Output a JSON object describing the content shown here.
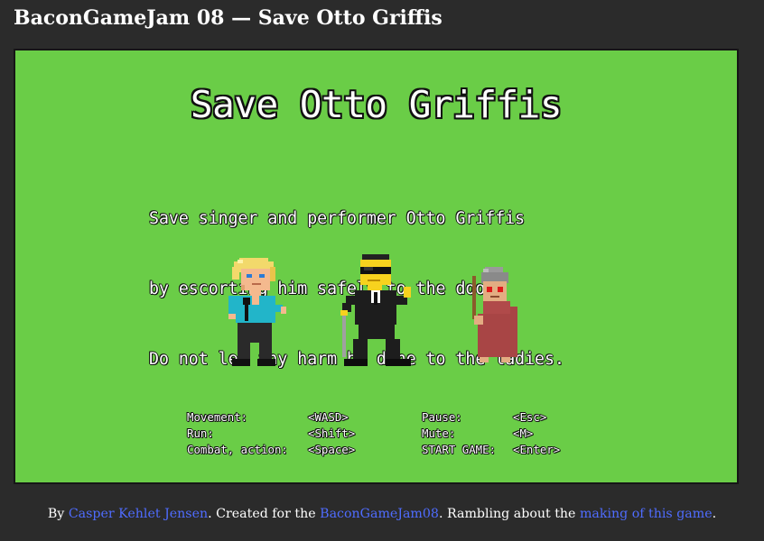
{
  "page": {
    "title": "BaconGameJam 08 — Save Otto Griffis"
  },
  "game": {
    "title": "Save Otto Griffis",
    "intro_lines": [
      "Save singer and performer Otto Griffis",
      "by escorting him safely to the door.",
      "Do not let any harm be done to the ladies."
    ],
    "characters": [
      {
        "name": "otto-griffis",
        "icon": "singer-sprite"
      },
      {
        "name": "bodyguard",
        "icon": "bodyguard-sprite"
      },
      {
        "name": "old-lady",
        "icon": "old-lady-sprite"
      }
    ],
    "controls_left": [
      {
        "label": "Movement:",
        "key": "<WASD>"
      },
      {
        "label": "Run:",
        "key": "<Shift>"
      },
      {
        "label": "Combat, action:",
        "key": "<Space>"
      }
    ],
    "controls_right": [
      {
        "label": "Pause:",
        "key": "<Esc>"
      },
      {
        "label": "Mute:",
        "key": "<M>"
      },
      {
        "label": "START GAME:",
        "key": "<Enter>"
      }
    ]
  },
  "footer": {
    "by": "By ",
    "author": "Casper Kehlet Jensen",
    "created": ". Created for the ",
    "jam": "BaconGameJam08",
    "rambling": ". Rambling about the ",
    "making": "making of this game",
    "end": "."
  },
  "colors": {
    "page_background": "#2b2b2b",
    "game_background": "#6acd47",
    "link": "#4f6cff",
    "text": "#ffffff"
  }
}
